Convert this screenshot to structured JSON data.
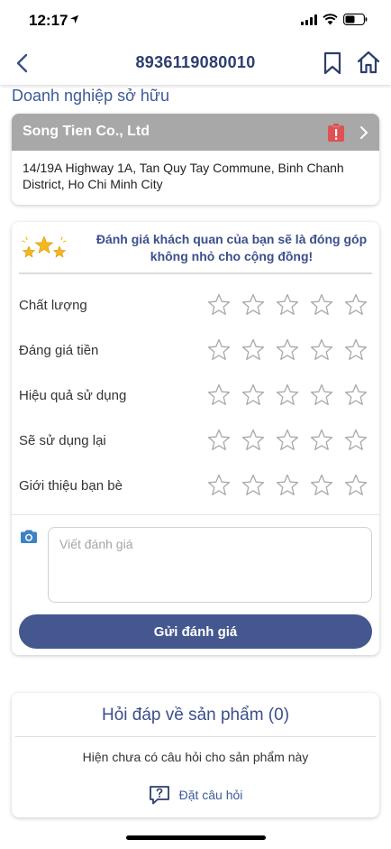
{
  "status_bar": {
    "time": "12:17"
  },
  "nav": {
    "title": "8936119080010"
  },
  "owner": {
    "heading": "Doanh nghiệp sở hữu",
    "company_name": "Song Tien Co., Ltd",
    "address": "14/19A Highway 1A, Tan Quy Tay Commune, Binh Chanh District, Ho Chi Minh City"
  },
  "rating": {
    "banner": "Đánh giá khách quan của bạn sẽ là đóng góp không nhỏ cho cộng đồng!",
    "criteria": [
      {
        "label": "Chất lượng",
        "stars": 0
      },
      {
        "label": "Đáng giá tiền",
        "stars": 0
      },
      {
        "label": "Hiệu quả sử dụng",
        "stars": 0
      },
      {
        "label": "Sẽ sử dụng lại",
        "stars": 0
      },
      {
        "label": "Giới thiệu bạn bè",
        "stars": 0
      }
    ],
    "max_stars": 5,
    "review_placeholder": "Viết đánh giá",
    "review_value": "",
    "submit_label": "Gửi đánh giá"
  },
  "qa": {
    "title": "Hỏi đáp về sản phẩm (0)",
    "empty_text": "Hiện chưa có câu hỏi cho sản phẩm này",
    "ask_label": "Đặt câu hỏi"
  },
  "colors": {
    "primary": "#44588f",
    "title_blue": "#2c3e6e",
    "badge_red": "#e05252",
    "star_gold": "#f5b81c",
    "header_gray": "#a8a8a8"
  },
  "icons": [
    "location-arrow-icon",
    "signal-icon",
    "wifi-icon",
    "battery-icon",
    "back-icon",
    "bookmark-icon",
    "home-icon",
    "report-badge-icon",
    "chevron-right-icon",
    "stars-badge-icon",
    "star-icon",
    "camera-icon",
    "question-icon"
  ]
}
